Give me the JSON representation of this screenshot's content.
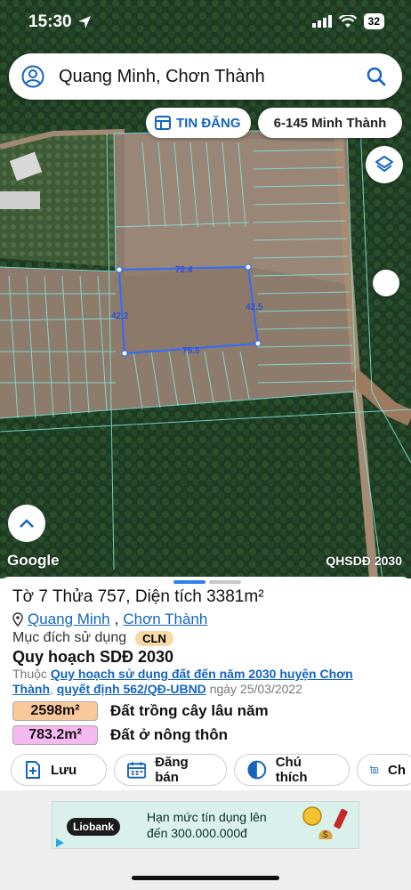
{
  "status_bar": {
    "time": "15:30",
    "battery": "32"
  },
  "search": {
    "query": "Quang Minh, Chơn Thành"
  },
  "chips": {
    "tin_dang": "TIN ĐĂNG",
    "parcel": "6-145 Minh Thành"
  },
  "map": {
    "dimensions": {
      "top": "72.4",
      "right": "42.5",
      "bottom": "75.5",
      "left": "42.2"
    },
    "google": "Google",
    "layer_badge": "QHSDĐ 2030"
  },
  "parcel": {
    "title": "Tờ 7 Thửa 757, Diện tích 3381m²",
    "ward": "Quang Minh",
    "separator": ",",
    "district": "Chơn Thành",
    "purpose_label": "Mục đích sử dụng",
    "purpose_code": "CLN",
    "plan_title": "Quy hoạch SDĐ 2030",
    "plan_prefix": "Thuộc",
    "plan_link": "Quy hoạch sử dụng đất đến năm 2030 huyện Chơn Thành",
    "plan_comma": ",",
    "decision_link": "quyết định 562/QĐ-UBND",
    "plan_date": "ngày 25/03/2022",
    "areas": [
      {
        "value": "2598m²",
        "label": "Đất trồng cây lâu năm",
        "color": "#f9c89b"
      },
      {
        "value": "783.2m²",
        "label": "Đất ở nông thôn",
        "color": "#f6b8f0"
      }
    ]
  },
  "actions": {
    "save": "Lưu",
    "post_sale": "Đăng bán",
    "legend": "Chú thích",
    "capture": "Ch"
  },
  "ad": {
    "brand": "Liobank",
    "line1": "Hạn mức tín dụng lên",
    "line2": "đến 300.000.000đ"
  },
  "colors": {
    "accent": "#1565c0",
    "parcel_outline": "#2f6bff",
    "plan_lines": "#7fe7e0"
  }
}
